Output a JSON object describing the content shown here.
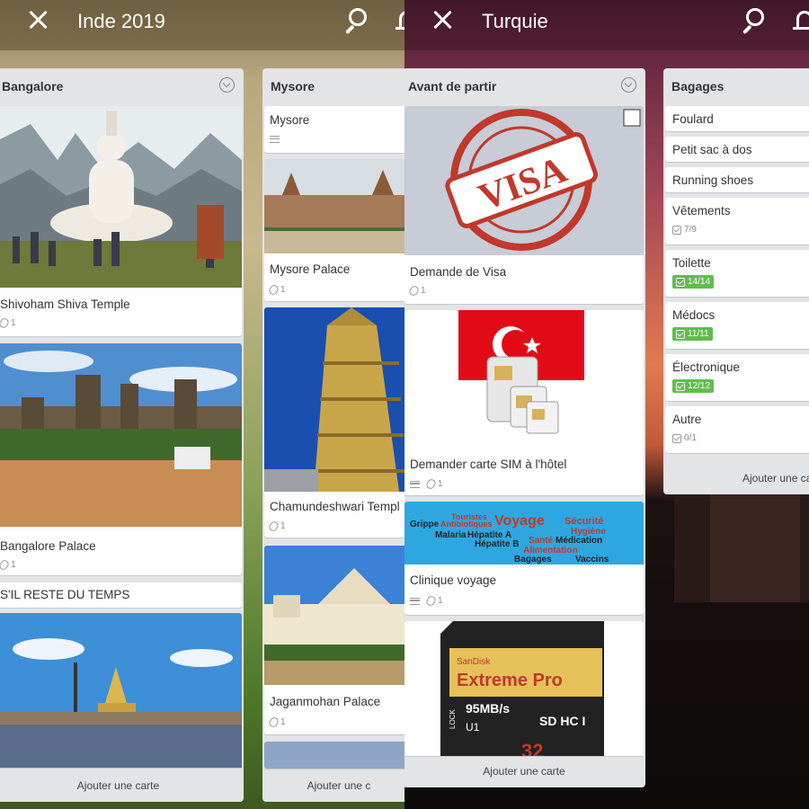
{
  "left_board": {
    "title": "Inde 2019",
    "lists": [
      {
        "name": "Bangalore",
        "cards": [
          {
            "title": "Shivoham Shiva Temple",
            "attachments": "1"
          },
          {
            "title": "Bangalore Palace",
            "attachments": "1"
          },
          {
            "title": "S'IL RESTE DU TEMPS"
          }
        ],
        "add_card": "Ajouter une carte"
      },
      {
        "name": "Mysore",
        "cards": [
          {
            "title": "Mysore"
          },
          {
            "title": "Mysore Palace",
            "attachments": "1"
          },
          {
            "title": "Chamundeshwari Templ",
            "attachments": "1"
          },
          {
            "title": "Jaganmohan Palace",
            "attachments": "1"
          }
        ],
        "add_card": "Ajouter une c"
      }
    ]
  },
  "right_board": {
    "title": "Turquie",
    "lists": [
      {
        "name": "Avant de partir",
        "cards": [
          {
            "title": "Demande de Visa",
            "attachments": "1",
            "cover_text": "VISA"
          },
          {
            "title": "Demander carte SIM à l'hôtel",
            "attachments": "1"
          },
          {
            "title": "Clinique voyage",
            "attachments": "1",
            "cover_words": [
              "Voyage",
              "Touristes",
              "Antibiotiques",
              "Sécurité",
              "Hygiène",
              "Grippe",
              "Malaria",
              "Hépatite A",
              "Hépatite B",
              "Santé",
              "Médication",
              "Alimentation",
              "Bagages",
              "Vaccins"
            ]
          },
          {
            "cover_brand": "SanDisk",
            "cover_product": "Extreme Pro",
            "cover_speed": "95MB/s",
            "cover_logo": "SD HC I",
            "cover_lock": "LOCK",
            "cover_class": "U1",
            "cover_capacity": "32"
          }
        ],
        "add_card": "Ajouter une carte"
      },
      {
        "name": "Bagages",
        "cards": [
          {
            "title": "Foulard"
          },
          {
            "title": "Petit sac à dos"
          },
          {
            "title": "Running shoes"
          },
          {
            "title": "Vêtements",
            "checklist": "7/9"
          },
          {
            "title": "Toilette",
            "checklist": "14/14"
          },
          {
            "title": "Médocs",
            "checklist": "11/11"
          },
          {
            "title": "Électronique",
            "checklist": "12/12"
          },
          {
            "title": "Autre",
            "checklist": "0/1"
          }
        ],
        "add_card": "Ajouter une ca"
      }
    ]
  }
}
